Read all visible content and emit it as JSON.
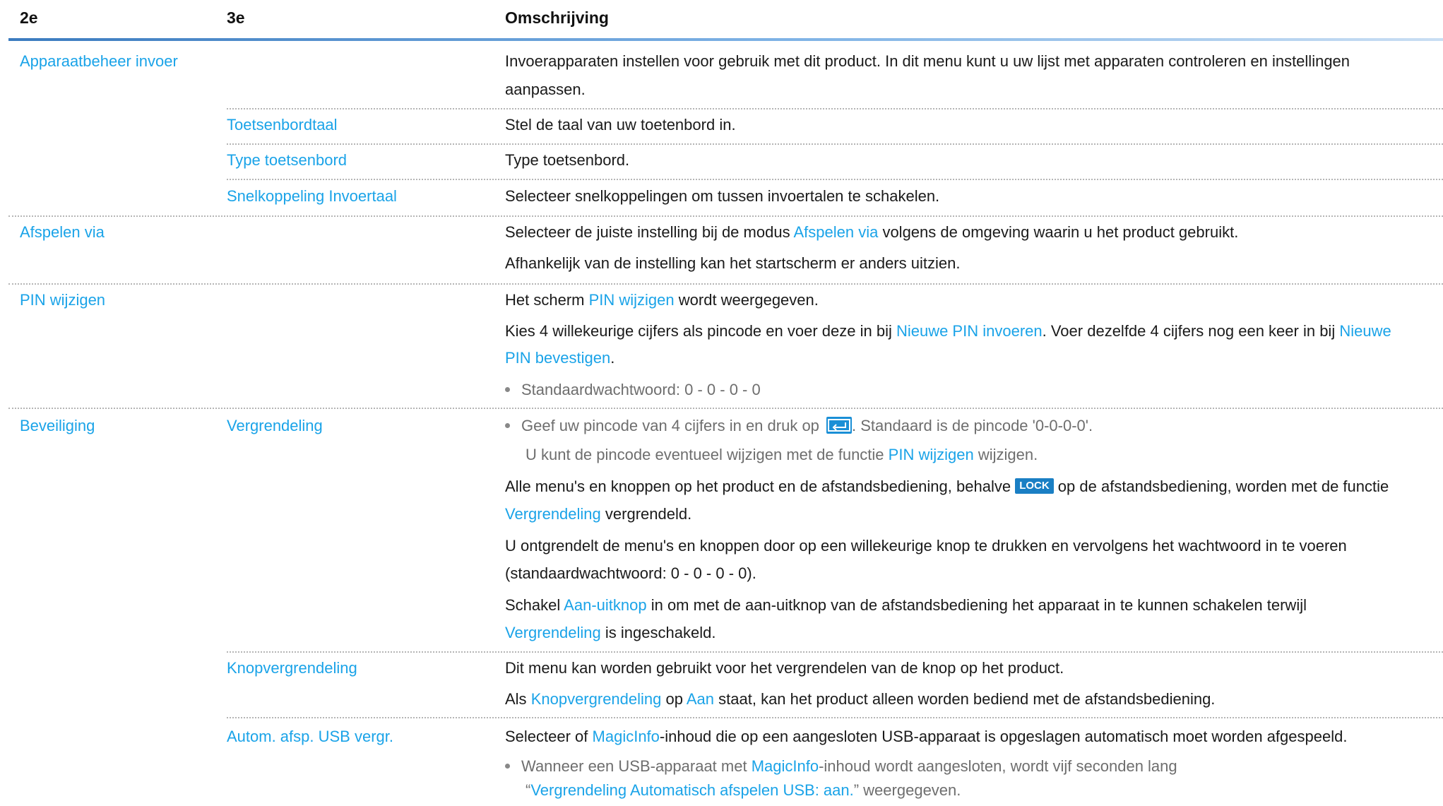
{
  "header": {
    "col1": "2e",
    "col2": "3e",
    "col3": "Omschrijving"
  },
  "rows": {
    "apparaat": {
      "c1": "Apparaatbeheer invoer",
      "d1": "Invoerapparaten instellen voor gebruik met dit product. In dit menu kunt u uw lijst met apparaten controleren en instellingen",
      "d2": "aanpassen.",
      "toetsenbordtaal": {
        "c2": "Toetsenbordtaal",
        "d": "Stel de taal van uw toetenbord in."
      },
      "type": {
        "c2": "Type toetsenbord",
        "d": "Type toetsenbord."
      },
      "snel": {
        "c2": "Snelkoppeling Invoertaal",
        "d": "Selecteer snelkoppelingen om tussen invoertalen te schakelen."
      }
    },
    "afspelen": {
      "c1": "Afspelen via",
      "d1a": "Selecteer de juiste instelling bij de modus ",
      "d1b": "Afspelen via",
      "d1c": " volgens de omgeving waarin u het product gebruikt.",
      "d2": "Afhankelijk van de instelling kan het startscherm er anders uitzien."
    },
    "pin": {
      "c1": "PIN wijzigen",
      "d1a": "Het scherm ",
      "d1b": "PIN wijzigen",
      "d1c": " wordt weergegeven.",
      "d2a": "Kies 4 willekeurige cijfers als pincode en voer deze in bij ",
      "d2b": "Nieuwe PIN invoeren",
      "d2c": ". Voer dezelfde 4 cijfers nog een keer in bij ",
      "d2d": "Nieuwe",
      "d3a": "PIN bevestigen",
      "d3b": ".",
      "bullet": "Standaardwachtwoord: 0 - 0 - 0 - 0"
    },
    "beveiliging": {
      "c1": "Beveiliging",
      "vergrendeling": {
        "c2": "Vergrendeling",
        "b1a": "Geef uw pincode van 4 cijfers in en druk op ",
        "b1b": ". Standaard is de pincode '0-0-0-0'.",
        "b2a": "U kunt de pincode eventueel wijzigen met de functie ",
        "b2b": "PIN wijzigen",
        "b2c": " wijzigen.",
        "p1a": "Alle menu's en knoppen op het product en de afstandsbediening, behalve ",
        "lock": "LOCK",
        "p1b": " op de afstandsbediening, worden met de functie",
        "p2a": "Vergrendeling",
        "p2b": " vergrendeld.",
        "p3": "U ontgrendelt de menu's en knoppen door op een willekeurige knop te drukken en vervolgens het wachtwoord in te voeren",
        "p4": "(standaardwachtwoord: 0 - 0 - 0 - 0).",
        "p5a": "Schakel ",
        "p5b": "Aan-uitknop",
        "p5c": " in om met de aan-uitknop van de afstandsbediening het apparaat in te kunnen schakelen terwijl",
        "p6a": "Vergrendeling",
        "p6b": " is ingeschakeld."
      },
      "knop": {
        "c2": "Knopvergrendeling",
        "d1": "Dit menu kan worden gebruikt voor het vergrendelen van de knop op het product.",
        "d2a": "Als ",
        "d2b": "Knopvergrendeling",
        "d2c": " op ",
        "d2d": "Aan",
        "d2e": " staat, kan het product alleen worden bediend met de afstandsbediening."
      },
      "autom": {
        "c2": "Autom. afsp. USB vergr.",
        "d1a": "Selecteer of ",
        "d1b": "MagicInfo",
        "d1c": "-inhoud die op een aangesloten USB-apparaat is opgeslagen automatisch moet worden afgespeeld.",
        "b1a": "Wanneer een USB-apparaat met ",
        "b1b": "MagicInfo",
        "b1c": "-inhoud wordt aangesloten, wordt vijf seconden lang",
        "b2a": "“",
        "b2b": "Vergrendeling Automatisch afspelen USB: aan.",
        "b2c": "” weergegeven."
      }
    }
  },
  "colors": {
    "link": "#1aa3e8",
    "header_rule": "#3b7bbf",
    "separator": "#b5b5b5"
  },
  "icons": {
    "enter": "enter-key-icon",
    "lock": "lock-button-badge"
  }
}
